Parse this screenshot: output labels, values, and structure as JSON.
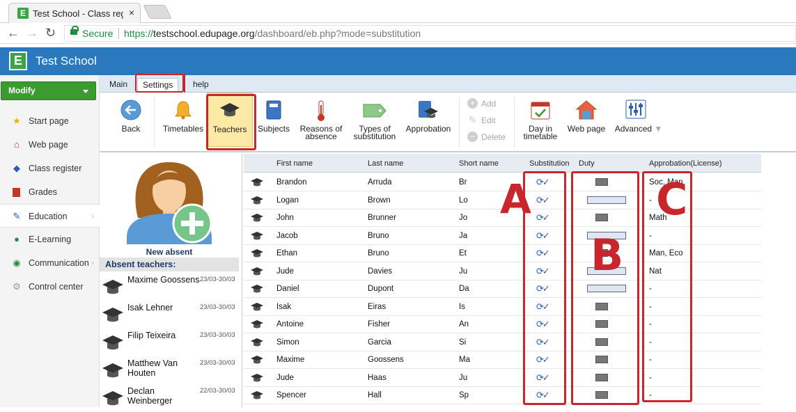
{
  "browser": {
    "tab_title": "Test School - Class regist",
    "tab_close": "×",
    "secure_label": "Secure",
    "url_scheme": "https://",
    "url_host": "testschool.edupage.org",
    "url_path": "/dashboard/eb.php?mode=substitution"
  },
  "app": {
    "logo_letter": "E",
    "title": "Test School",
    "brand_color": "#2a78bd",
    "accent_green": "#3b9b2f"
  },
  "sidebar": {
    "modify_label": "Modify",
    "items": [
      {
        "label": "Start page",
        "icon": "star-icon"
      },
      {
        "label": "Web page",
        "icon": "house-icon"
      },
      {
        "label": "Class register",
        "icon": "book-icon"
      },
      {
        "label": "Grades",
        "icon": "grades-icon"
      },
      {
        "label": "Education",
        "icon": "pencil-icon"
      },
      {
        "label": "E-Learning",
        "icon": "globe-icon"
      },
      {
        "label": "Communication",
        "icon": "globe-people-icon"
      },
      {
        "label": "Control center",
        "icon": "gear-icon"
      }
    ]
  },
  "ribbon": {
    "tabs": [
      "Main",
      "Settings",
      "help"
    ],
    "selected_tab": "Settings",
    "buttons": {
      "back": "Back",
      "timetables": "Timetables",
      "teachers": "Teachers",
      "subjects": "Subjects",
      "reasons_l1": "Reasons of",
      "reasons_l2": "absence",
      "types_l1": "Types of",
      "types_l2": "substitution",
      "approbation": "Approbation",
      "add": "Add",
      "edit": "Edit",
      "delete": "Delete",
      "day_l1": "Day in",
      "day_l2": "timetable",
      "web_page": "Web page",
      "advanced": "Advanced"
    }
  },
  "absent_panel": {
    "new_absent": "New absent",
    "header": "Absent teachers:",
    "teachers": [
      {
        "name": "Maxime Goossens",
        "dates": "23/03-30/03"
      },
      {
        "name": "Isak Lehner",
        "dates": "23/03-30/03"
      },
      {
        "name": "Filip Teixeira",
        "dates": "23/03-30/03"
      },
      {
        "name": "Matthew Van Houten",
        "dates": "23/03-30/03"
      },
      {
        "name": "Declan Weinberger",
        "dates": "22/03-30/03"
      }
    ]
  },
  "table": {
    "headers": {
      "first_name": "First name",
      "last_name": "Last name",
      "short_name": "Short name",
      "substitution": "Substitution",
      "duty": "Duty",
      "approbation": "Approbation(License)"
    },
    "rows": [
      {
        "first": "Brandon",
        "last": "Arruda",
        "short": "Br",
        "duty": "small",
        "approbation": "Soc, Man"
      },
      {
        "first": "Logan",
        "last": "Brown",
        "short": "Lo",
        "duty": "wide",
        "approbation": "-"
      },
      {
        "first": "John",
        "last": "Brunner",
        "short": "Jo",
        "duty": "small",
        "approbation": "Math"
      },
      {
        "first": "Jacob",
        "last": "Bruno",
        "short": "Ja",
        "duty": "wide",
        "approbation": "-"
      },
      {
        "first": "Ethan",
        "last": "Bruno",
        "short": "Et",
        "duty": "small",
        "approbation": "Man, Eco"
      },
      {
        "first": "Jude",
        "last": "Davies",
        "short": "Ju",
        "duty": "wide",
        "approbation": "Nat"
      },
      {
        "first": "Daniel",
        "last": "Dupont",
        "short": "Da",
        "duty": "wide",
        "approbation": "-"
      },
      {
        "first": "Isak",
        "last": "Eiras",
        "short": "Is",
        "duty": "small",
        "approbation": "-"
      },
      {
        "first": "Antoine",
        "last": "Fisher",
        "short": "An",
        "duty": "small",
        "approbation": "-"
      },
      {
        "first": "Simon",
        "last": "Garcia",
        "short": "Si",
        "duty": "small",
        "approbation": "-"
      },
      {
        "first": "Maxime",
        "last": "Goossens",
        "short": "Ma",
        "duty": "small",
        "approbation": "-"
      },
      {
        "first": "Jude",
        "last": "Haas",
        "short": "Ju",
        "duty": "small",
        "approbation": "-"
      },
      {
        "first": "Spencer",
        "last": "Hall",
        "short": "Sp",
        "duty": "small",
        "approbation": "-"
      }
    ]
  },
  "annotations": {
    "letters": [
      "A",
      "B",
      "C"
    ],
    "color": "#c8262c"
  }
}
